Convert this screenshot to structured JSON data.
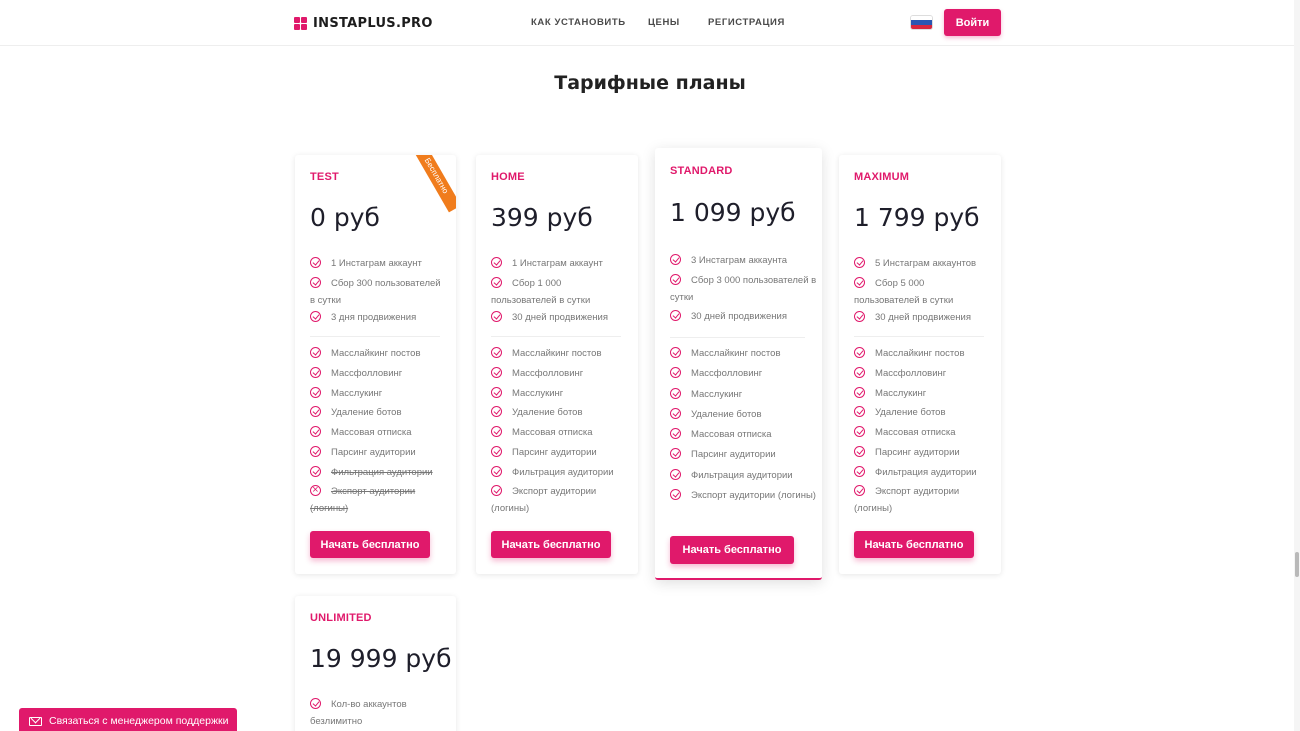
{
  "header": {
    "logo_text": "INSTAPLUS.PRO",
    "nav": [
      "КАК УСТАНОВИТЬ",
      "ЦЕНЫ",
      "РЕГИСТРАЦИЯ"
    ],
    "language": "ru",
    "login_label": "Войти"
  },
  "page": {
    "title": "Тарифные планы"
  },
  "plans": [
    {
      "name": "TEST",
      "price": "0 руб",
      "ribbon": "Бесплатно",
      "limits": [
        "1 Инстаграм аккаунт",
        "Сбор 300 пользователей в сутки",
        "3 дня продвижения"
      ],
      "features": [
        "Масслайкинг постов",
        "Массфолловинг",
        "Масслукинг",
        "Удаление ботов",
        "Массовая отписка",
        "Парсинг аудитории",
        "Фильтрация аудитории",
        "Экспорт аудитории (логины)"
      ],
      "cta": "Начать бесплатно"
    },
    {
      "name": "HOME",
      "price": "399 руб",
      "limits": [
        "1 Инстаграм аккаунт",
        "Сбор 1 000 пользователей в сутки",
        "30 дней продвижения"
      ],
      "features": [
        "Масслайкинг постов",
        "Массфолловинг",
        "Масслукинг",
        "Удаление ботов",
        "Массовая отписка",
        "Парсинг аудитории",
        "Фильтрация аудитории",
        "Экспорт аудитории (логины)"
      ],
      "cta": "Начать бесплатно"
    },
    {
      "name": "STANDARD",
      "price": "1 099 руб",
      "limits": [
        "3 Инстаграм аккаунта",
        "Сбор 3 000 пользователей в сутки",
        "30 дней продвижения"
      ],
      "features": [
        "Масслайкинг постов",
        "Массфолловинг",
        "Масслукинг",
        "Удаление ботов",
        "Массовая отписка",
        "Парсинг аудитории",
        "Фильтрация аудитории",
        "Экспорт аудитории (логины)"
      ],
      "cta": "Начать бесплатно"
    },
    {
      "name": "MAXIMUM",
      "price": "1 799 руб",
      "limits": [
        "5 Инстаграм аккаунтов",
        "Сбор 5 000 пользователей в сутки",
        "30 дней продвижения"
      ],
      "features": [
        "Масслайкинг постов",
        "Массфолловинг",
        "Масслукинг",
        "Удаление ботов",
        "Массовая отписка",
        "Парсинг аудитории",
        "Фильтрация аудитории",
        "Экспорт аудитории (логины)"
      ],
      "cta": "Начать бесплатно"
    },
    {
      "name": "UNLIMITED",
      "price": "19 999 руб",
      "limits": [
        "Кол-во аккаунтов безлимитно"
      ]
    }
  ],
  "support": {
    "label": "Связаться с менеджером поддержки"
  },
  "colors": {
    "accent": "#e0196b",
    "ribbon": "#f07c1c"
  }
}
